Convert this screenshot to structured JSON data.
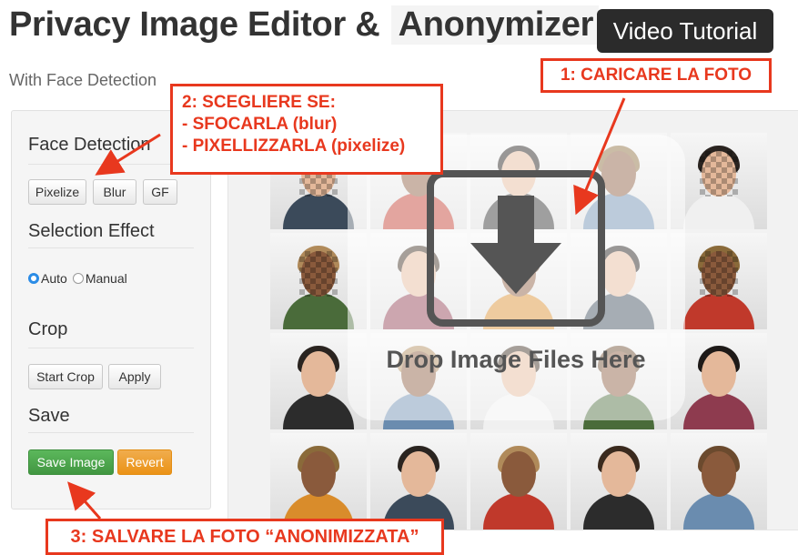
{
  "header": {
    "title_part1": "Privacy Image Editor &",
    "title_part2": "Anonymizer",
    "subtitle": "With Face Detection",
    "video_button": "Video Tutorial"
  },
  "sidebar": {
    "face_detection": {
      "heading": "Face Detection",
      "buttons": [
        "Pixelize",
        "Blur",
        "GF"
      ]
    },
    "selection_effect": {
      "heading": "Selection Effect",
      "options": [
        "Auto",
        "Manual"
      ],
      "selected": "Auto"
    },
    "crop": {
      "heading": "Crop",
      "buttons": [
        "Start Crop",
        "Apply"
      ]
    },
    "save": {
      "heading": "Save",
      "save_button": "Save Image",
      "revert_button": "Revert"
    }
  },
  "main": {
    "drop_text": "Drop Image Files Here",
    "drop_icon": "download-arrow-icon"
  },
  "annotations": {
    "step1": "1: CARICARE LA FOTO",
    "step2_title": "2: SCEGLIERE SE:",
    "step2_line1": "- SFOCARLA (blur)",
    "step2_line2": "- PIXELLIZZARLA (pixelize)",
    "step3": "3: SALVARE LA FOTO “ANONIMIZZATA”"
  },
  "colors": {
    "annotation_red": "#e8381e",
    "save_green": "#5cb85c",
    "revert_orange": "#f0ad4e",
    "radio_blue": "#2b8ce6",
    "video_button_bg": "#2b2b2b"
  }
}
